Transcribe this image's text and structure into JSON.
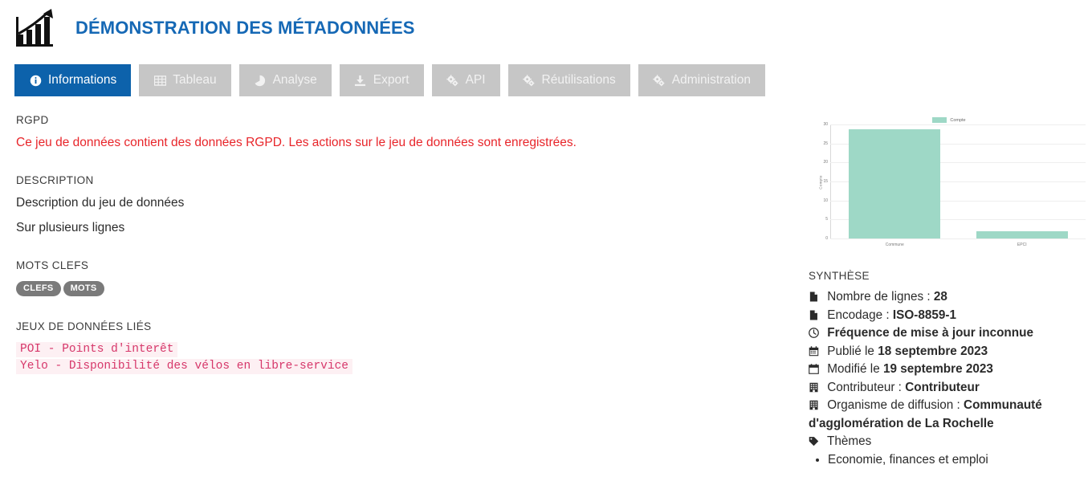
{
  "header": {
    "title": "DÉMONSTRATION DES MÉTADONNÉES",
    "logo_icon": "bar-chart-growth-icon"
  },
  "tabs": [
    {
      "label": "Informations",
      "icon": "info-circle-icon",
      "active": true
    },
    {
      "label": "Tableau",
      "icon": "table-icon",
      "active": false
    },
    {
      "label": "Analyse",
      "icon": "pie-chart-icon",
      "active": false
    },
    {
      "label": "Export",
      "icon": "download-icon",
      "active": false
    },
    {
      "label": "API",
      "icon": "cogs-icon",
      "active": false
    },
    {
      "label": "Réutilisations",
      "icon": "cogs-icon",
      "active": false
    },
    {
      "label": "Administration",
      "icon": "cogs-icon",
      "active": false
    }
  ],
  "main": {
    "rgpd": {
      "label": "RGPD",
      "text": "Ce jeu de données contient des données RGPD. Les actions sur le jeu de données sont enregistrées."
    },
    "description": {
      "label": "DESCRIPTION",
      "lines": [
        "Description du jeu de données",
        "Sur plusieurs lignes"
      ]
    },
    "keywords": {
      "label": "MOTS CLEFS",
      "tags": [
        "CLEFS",
        "MOTS"
      ]
    },
    "linked_datasets": {
      "label": "JEUX DE DONNÉES LIÉS",
      "items": [
        "POI - Points d'interêt",
        "Yelo - Disponibilité des vélos en libre-service"
      ]
    }
  },
  "synthesis": {
    "label": "SYNTHÈSE",
    "rows": [
      {
        "icon": "file-icon",
        "prefix": "Nombre de lignes : ",
        "value": "28"
      },
      {
        "icon": "file-icon",
        "prefix": "Encodage : ",
        "value": "ISO-8859-1"
      },
      {
        "icon": "clock-icon",
        "prefix": "",
        "value": "Fréquence de mise à jour inconnue"
      },
      {
        "icon": "calendar-icon",
        "prefix": "Publié le ",
        "value": "18 septembre 2023"
      },
      {
        "icon": "calendar-icon",
        "prefix": "Modifié le ",
        "value": "19 septembre 2023"
      },
      {
        "icon": "building-icon",
        "prefix": "Contributeur : ",
        "value": "Contributeur"
      },
      {
        "icon": "building-icon",
        "prefix": "Organisme de diffusion : ",
        "value": "Communauté d'agglomération de La Rochelle"
      }
    ],
    "themes": {
      "icon": "tag-icon",
      "label": "Thèmes",
      "items": [
        "Economie, finances et emploi"
      ]
    }
  },
  "chart_data": {
    "type": "bar",
    "title": "",
    "categories": [
      "Commune",
      "EPCI"
    ],
    "values": [
      29,
      2
    ],
    "series": [
      {
        "name": "Compte",
        "values": [
          29,
          2
        ]
      }
    ],
    "legend": [
      "Compte"
    ],
    "legend_position": "top-center",
    "xlabel": "",
    "ylabel": "Compte",
    "ylim": [
      0,
      30
    ],
    "yticks": [
      0,
      5,
      10,
      15,
      20,
      25,
      30
    ],
    "grid": true,
    "bar_color": "#9ed8c6"
  },
  "colors": {
    "accent_blue": "#0d62ab",
    "title_blue": "#1568b5",
    "tab_inactive": "#c6c6c6",
    "rgpd_red": "#e8252a",
    "link_pink": "#d6376a",
    "chart_green": "#9ed8c6",
    "tag_gray": "#7a7a7a"
  }
}
